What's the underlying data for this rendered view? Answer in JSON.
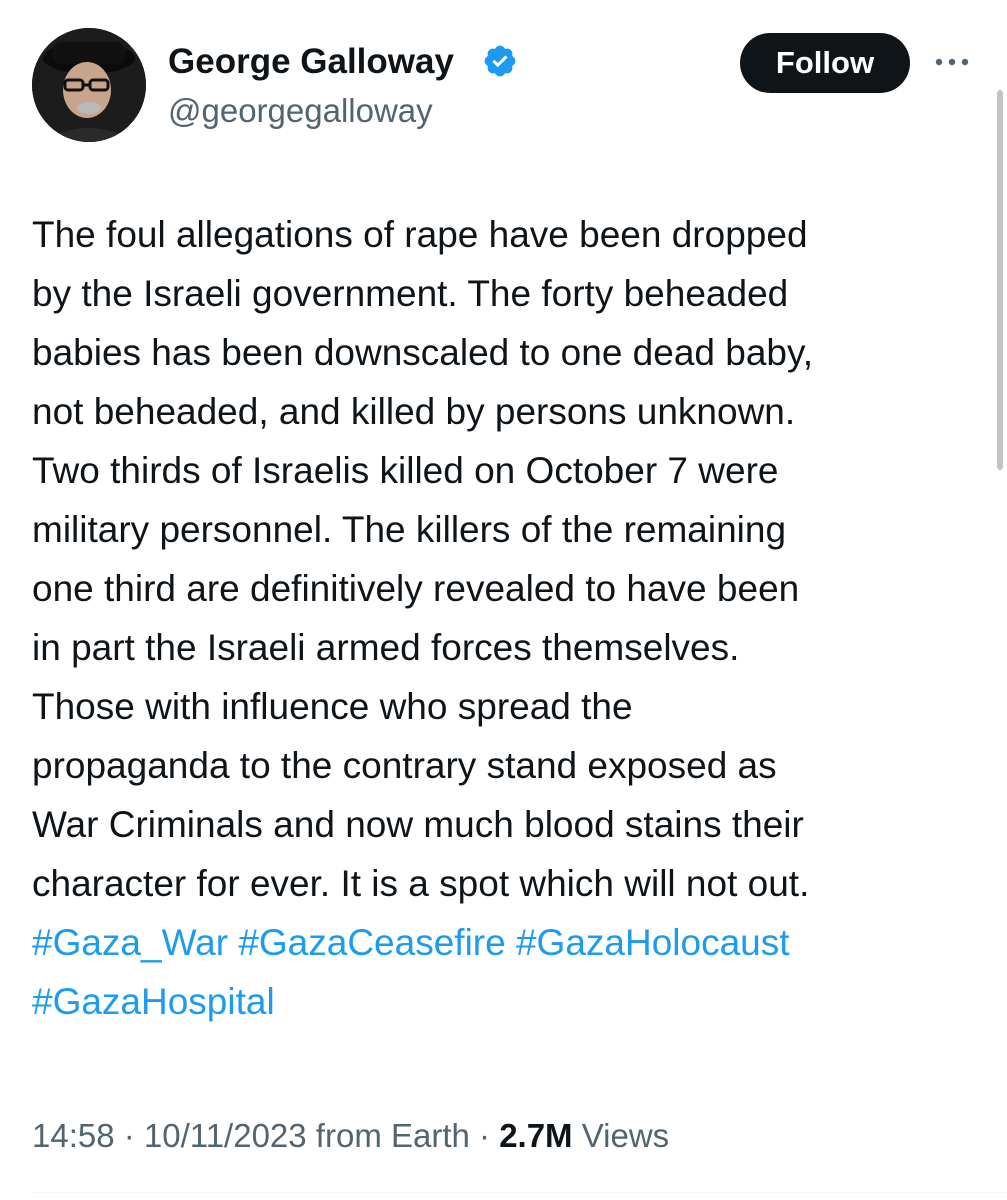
{
  "author": {
    "name": "George Galloway",
    "handle": "@georgegalloway",
    "verified": true,
    "avatar_icon": "profile-photo"
  },
  "follow_button": {
    "label": "Follow"
  },
  "more_icon": "ellipsis-icon",
  "tweet": {
    "lines": [
      "The foul allegations of rape have been dropped",
      "by the Israeli government. The forty beheaded",
      "babies has been downscaled to one dead baby,",
      "not beheaded, and killed by persons unknown.",
      "Two thirds of Israelis killed on October 7 were",
      "military personnel. The killers of the remaining",
      "one third are definitively revealed to have been",
      "in part the Israeli armed forces themselves.",
      "Those with influence who spread the",
      "propaganda to the contrary stand exposed as",
      "War Criminals and now much blood stains their",
      "character for ever. It is a spot which will not out."
    ],
    "hashtags": [
      "#Gaza_War",
      "#GazaCeasefire",
      "#GazaHolocaust",
      "#GazaHospital"
    ]
  },
  "meta": {
    "time": "14:58",
    "separator": " · ",
    "date": "10/11/2023",
    "source": " from Earth",
    "views_count": "2.7M",
    "views_label": " Views"
  },
  "colors": {
    "link": "#1d9bf0",
    "text": "#0f1419",
    "secondary": "#536471",
    "verified_badge": "#1d9bf0"
  }
}
